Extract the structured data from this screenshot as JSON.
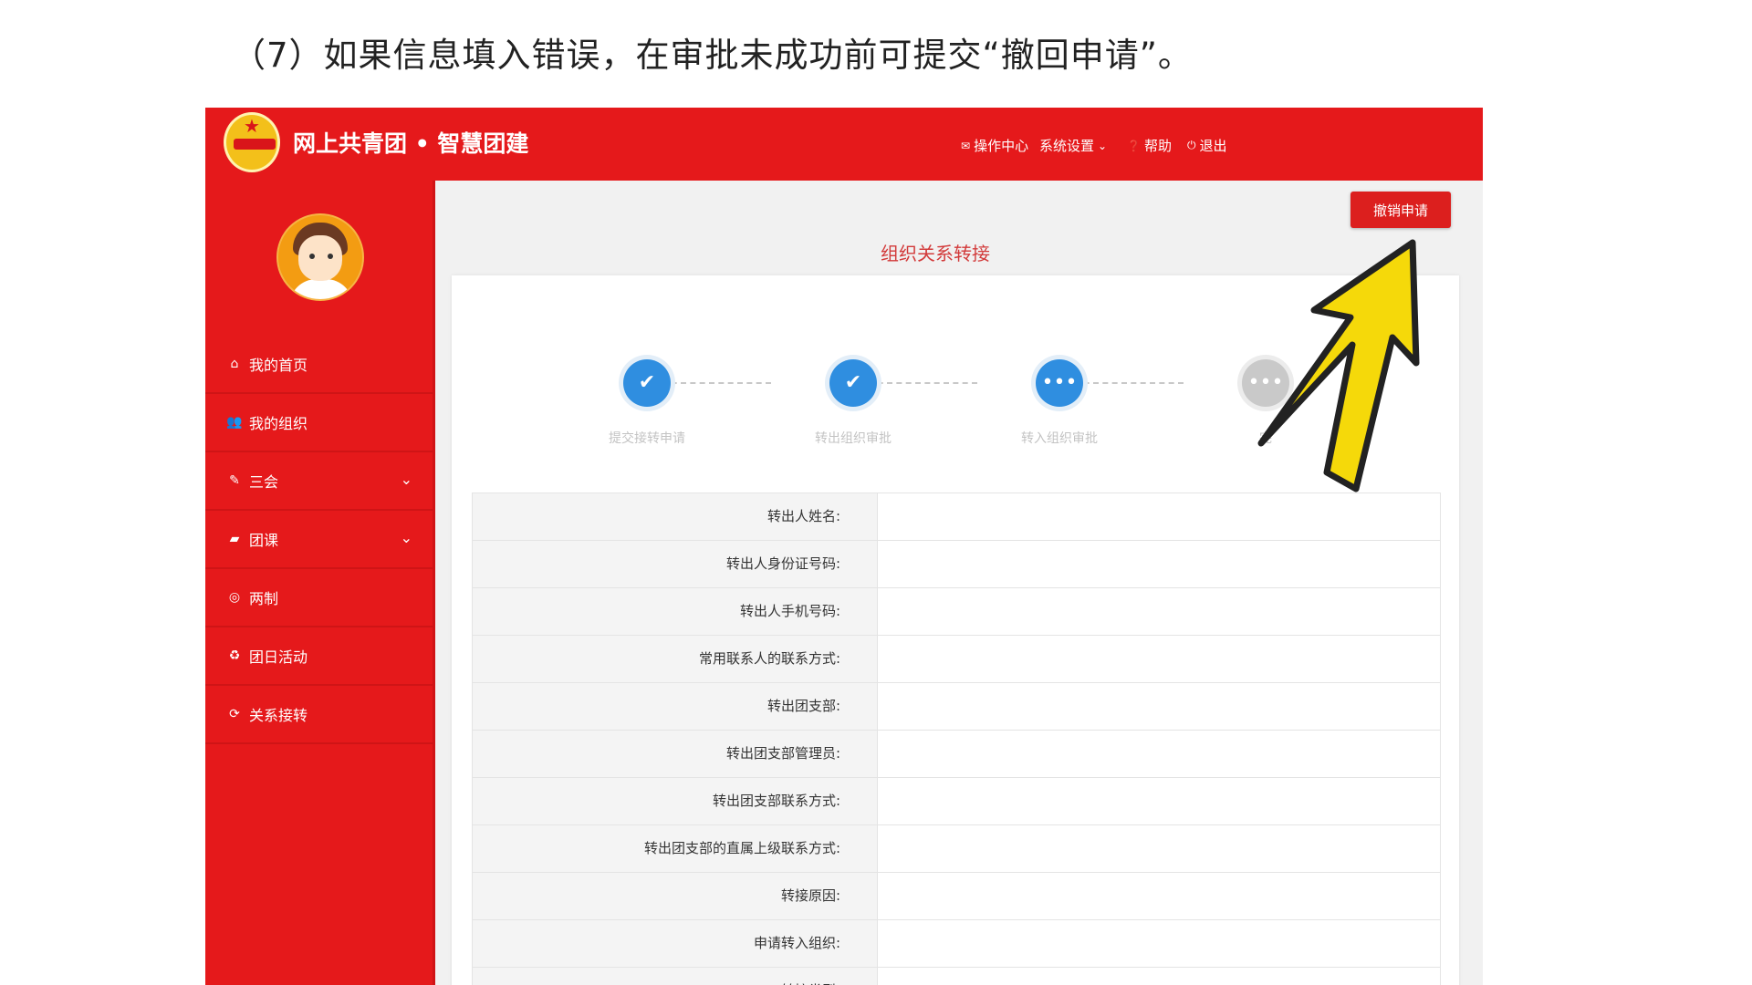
{
  "caption": "（7）如果信息填入错误，在审批未成功前可提交“撤回申请”。",
  "header": {
    "brand": "网上共青团 • 智慧团建",
    "nav": [
      {
        "icon": "envelope-icon",
        "label": "操作中心"
      },
      {
        "icon": "chevron-down-icon",
        "label": "系统设置"
      },
      {
        "icon": "help-icon",
        "label": "帮助"
      },
      {
        "icon": "power-icon",
        "label": "退出"
      }
    ]
  },
  "sidebar": {
    "items": [
      {
        "icon": "home-icon",
        "label": "我的首页",
        "expandable": false
      },
      {
        "icon": "users-icon",
        "label": "我的组织",
        "expandable": false
      },
      {
        "icon": "edit-icon",
        "label": "三会",
        "expandable": true
      },
      {
        "icon": "folder-icon",
        "label": "团课",
        "expandable": true
      },
      {
        "icon": "target-icon",
        "label": "两制",
        "expandable": false
      },
      {
        "icon": "recycle-icon",
        "label": "团日活动",
        "expandable": false
      },
      {
        "icon": "refresh-icon",
        "label": "关系接转",
        "expandable": false
      }
    ]
  },
  "main": {
    "revoke_button": "撤销申请",
    "title": "组织关系转接",
    "steps": [
      {
        "label": "提交接转申请",
        "status": "done"
      },
      {
        "label": "转出组织审批",
        "status": "done"
      },
      {
        "label": "转入组织审批",
        "status": "current"
      },
      {
        "label": "完",
        "status": "pending"
      }
    ],
    "fields": [
      {
        "label": "转出人姓名:",
        "value": ""
      },
      {
        "label": "转出人身份证号码:",
        "value": ""
      },
      {
        "label": "转出人手机号码:",
        "value": ""
      },
      {
        "label": "常用联系人的联系方式:",
        "value": ""
      },
      {
        "label": "转出团支部:",
        "value": ""
      },
      {
        "label": "转出团支部管理员:",
        "value": ""
      },
      {
        "label": "转出团支部联系方式:",
        "value": ""
      },
      {
        "label": "转出团支部的直属上级联系方式:",
        "value": ""
      },
      {
        "label": "转接原因:",
        "value": ""
      },
      {
        "label": "申请转入组织:",
        "value": ""
      },
      {
        "label": "转接类型:",
        "value": ""
      }
    ]
  },
  "colors": {
    "primary": "#e5191b",
    "step_active": "#2f8ee0",
    "arrow": "#f5d90a"
  }
}
